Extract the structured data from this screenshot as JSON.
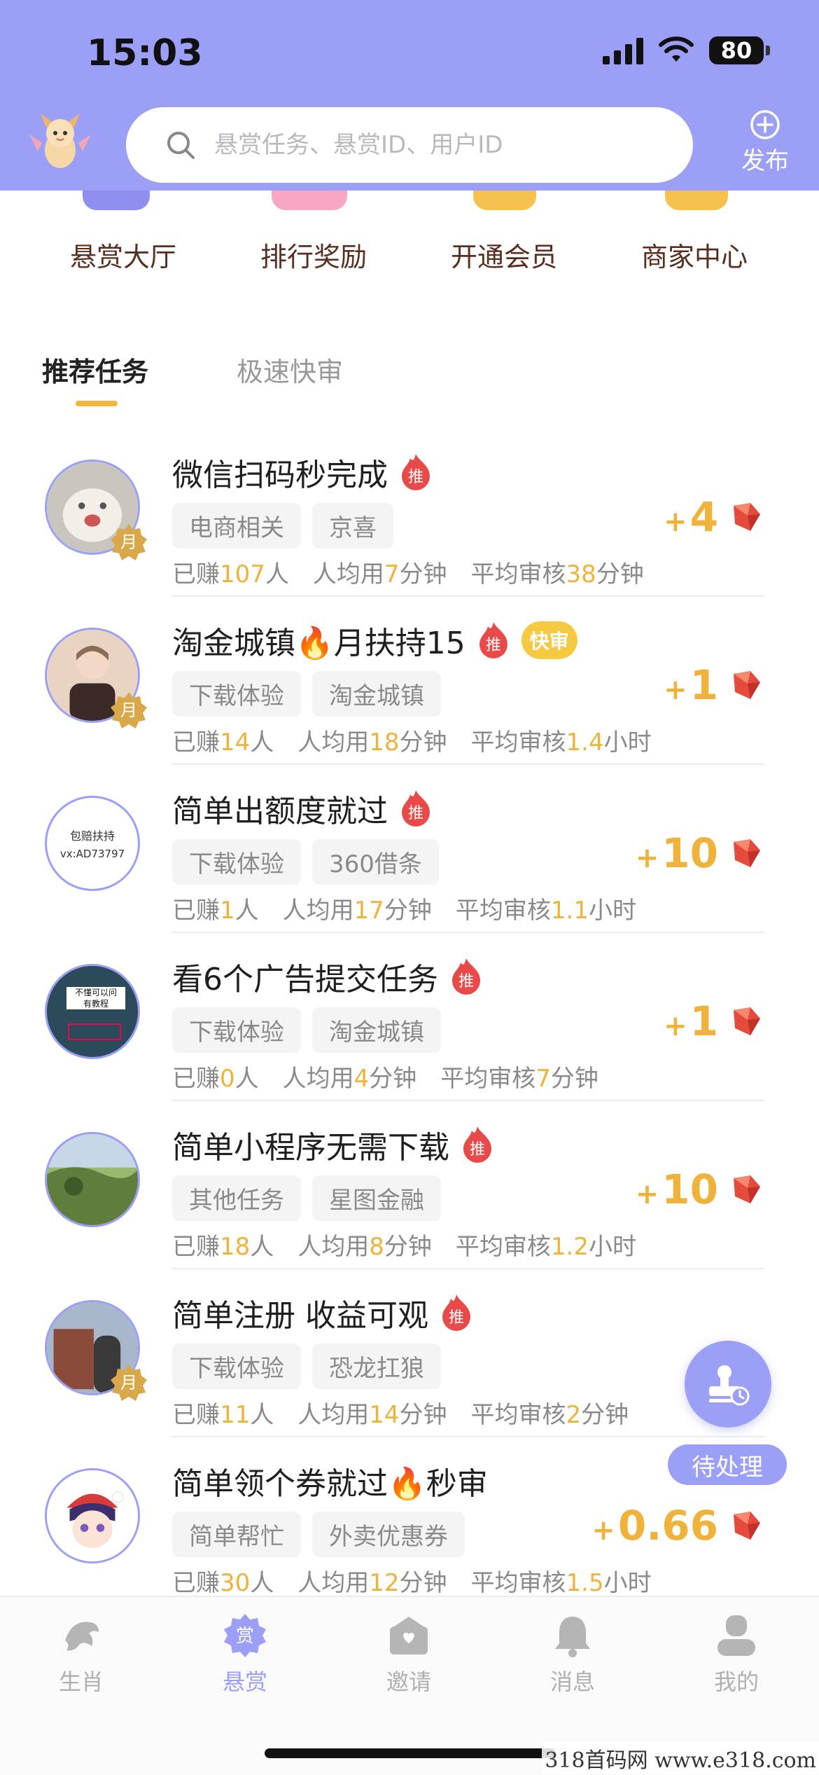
{
  "status_bar": {
    "time": "15:03",
    "battery": "80"
  },
  "header": {
    "search_placeholder": "悬赏任务、悬赏ID、用户ID",
    "publish_label": "发布"
  },
  "quick_menu": [
    "悬赏大厅",
    "排行奖励",
    "开通会员",
    "商家中心"
  ],
  "tabs": {
    "active": "推荐任务",
    "inactive": "极速快审"
  },
  "tasks": [
    {
      "title": "微信扫码秒完成",
      "badges": [
        "推"
      ],
      "tags": [
        "电商相关",
        "京喜"
      ],
      "earned_label": "已赚",
      "earned": "107",
      "earned_unit": "人",
      "avg_label": "人均用",
      "avg": "7",
      "avg_unit": "分钟",
      "review_label": "平均审核",
      "review": "38",
      "review_unit": "分钟",
      "reward_plus": "+",
      "reward": "4",
      "month_badge": "月"
    },
    {
      "title": "淘金城镇🔥月扶持15",
      "badges": [
        "推",
        "快审"
      ],
      "tags": [
        "下载体验",
        "淘金城镇"
      ],
      "earned_label": "已赚",
      "earned": "14",
      "earned_unit": "人",
      "avg_label": "人均用",
      "avg": "18",
      "avg_unit": "分钟",
      "review_label": "平均审核",
      "review": "1.4",
      "review_unit": "小时",
      "reward_plus": "+",
      "reward": "1",
      "month_badge": "月"
    },
    {
      "title": "简单出额度就过",
      "badges": [
        "推"
      ],
      "tags": [
        "下载体验",
        "360借条"
      ],
      "earned_label": "已赚",
      "earned": "1",
      "earned_unit": "人",
      "avg_label": "人均用",
      "avg": "17",
      "avg_unit": "分钟",
      "review_label": "平均审核",
      "review": "1.1",
      "review_unit": "小时",
      "reward_plus": "+",
      "reward": "10",
      "avatar_text_1": "包赔扶持",
      "avatar_text_2": "vx:AD73797"
    },
    {
      "title": "看6个广告提交任务",
      "badges": [
        "推"
      ],
      "tags": [
        "下载体验",
        "淘金城镇"
      ],
      "earned_label": "已赚",
      "earned": "0",
      "earned_unit": "人",
      "avg_label": "人均用",
      "avg": "4",
      "avg_unit": "分钟",
      "review_label": "平均审核",
      "review": "7",
      "review_unit": "分钟",
      "reward_plus": "+",
      "reward": "1",
      "avatar_text_1": "不懂可以问",
      "avatar_text_2": "有教程"
    },
    {
      "title": "简单小程序无需下载",
      "badges": [
        "推"
      ],
      "tags": [
        "其他任务",
        "星图金融"
      ],
      "earned_label": "已赚",
      "earned": "18",
      "earned_unit": "人",
      "avg_label": "人均用",
      "avg": "8",
      "avg_unit": "分钟",
      "review_label": "平均审核",
      "review": "1.2",
      "review_unit": "小时",
      "reward_plus": "+",
      "reward": "10"
    },
    {
      "title": "简单注册 收益可观",
      "badges": [
        "推"
      ],
      "tags": [
        "下载体验",
        "恐龙扛狼"
      ],
      "earned_label": "已赚",
      "earned": "11",
      "earned_unit": "人",
      "avg_label": "人均用",
      "avg": "14",
      "avg_unit": "分钟",
      "review_label": "平均审核",
      "review": "2",
      "review_unit": "分钟",
      "reward_plus": "+",
      "reward": "",
      "month_badge": "月"
    },
    {
      "title": "简单领个券就过🔥秒审",
      "badges": [],
      "tags": [
        "简单帮忙",
        "外卖优惠券"
      ],
      "earned_label": "已赚",
      "earned": "30",
      "earned_unit": "人",
      "avg_label": "人均用",
      "avg": "12",
      "avg_unit": "分钟",
      "review_label": "平均审核",
      "review": "1.5",
      "review_unit": "小时",
      "reward_plus": "+",
      "reward": "0.66"
    }
  ],
  "floating": {
    "pending_label": "待处理"
  },
  "bottom_nav": [
    "生肖",
    "悬赏",
    "邀请",
    "消息",
    "我的"
  ],
  "bottom_nav_active_index": 1,
  "nav_icon_text": "赏",
  "watermark": "318首码网 www.e318.com",
  "colors": {
    "header": "#9c9ff6",
    "accent_gold": "#efb23a",
    "badge_red": "#e84a4a"
  }
}
